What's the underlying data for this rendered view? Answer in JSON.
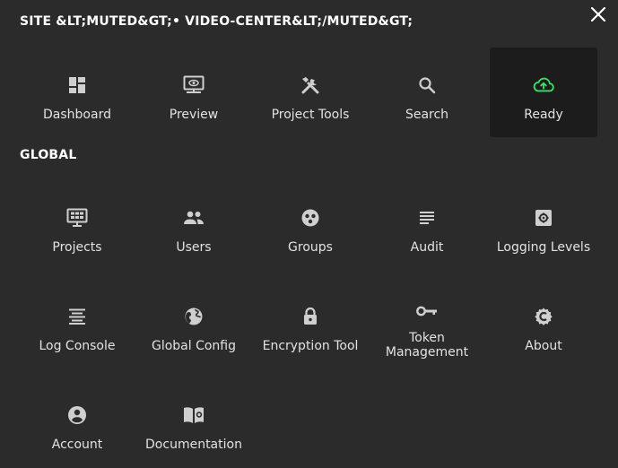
{
  "header": {
    "site_title": "SITE &LT;MUTED&GT;• VIDEO-CENTER&LT;/MUTED&GT;"
  },
  "site_tiles": [
    {
      "label": "Dashboard",
      "icon": "dashboard-icon"
    },
    {
      "label": "Preview",
      "icon": "preview-icon"
    },
    {
      "label": "Project Tools",
      "icon": "tools-icon"
    },
    {
      "label": "Search",
      "icon": "search-icon"
    },
    {
      "label": "Ready",
      "icon": "cloud-upload-icon",
      "active": true,
      "icon_color": "#3ddc6a"
    }
  ],
  "global": {
    "title": "GLOBAL",
    "tiles": [
      {
        "label": "Projects",
        "icon": "projects-icon"
      },
      {
        "label": "Users",
        "icon": "users-icon"
      },
      {
        "label": "Groups",
        "icon": "groups-icon"
      },
      {
        "label": "Audit",
        "icon": "audit-icon"
      },
      {
        "label": "Logging Levels",
        "icon": "logging-levels-icon"
      },
      {
        "label": "Log Console",
        "icon": "log-console-icon"
      },
      {
        "label": "Global Config",
        "icon": "globe-icon"
      },
      {
        "label": "Encryption Tool",
        "icon": "lock-icon"
      },
      {
        "label_line1": "Token",
        "label_line2": "Management",
        "icon": "key-icon"
      },
      {
        "label": "About",
        "icon": "about-icon"
      },
      {
        "label": "Account",
        "icon": "account-icon"
      },
      {
        "label": "Documentation",
        "icon": "documentation-icon"
      }
    ]
  },
  "colors": {
    "background": "#2b2b2b",
    "active_tile": "#1c1c1c",
    "icon": "#d0d0d0",
    "ready_icon": "#3ddc6a"
  }
}
